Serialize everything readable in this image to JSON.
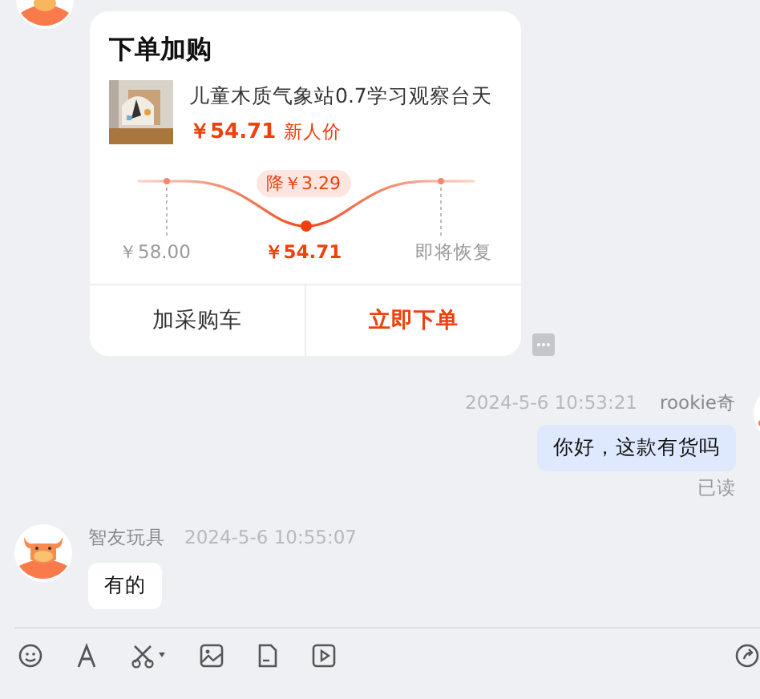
{
  "order_card": {
    "title": "下单加购",
    "product": {
      "name": "儿童木质气象站0.7学习观察台天",
      "price": "￥54.71",
      "price_tag": "新人价"
    },
    "price_chart": {
      "badge": "降￥3.29",
      "points": [
        {
          "label": "￥58.00",
          "current": false
        },
        {
          "label": "￥54.71",
          "current": true
        },
        {
          "label": "即将恢复",
          "current": false
        }
      ]
    },
    "buttons": [
      {
        "label": "加采购车",
        "primary": false
      },
      {
        "label": "立即下单",
        "primary": true
      }
    ]
  },
  "outgoing": {
    "time": "2024-5-6 10:53:21",
    "sender": "rookie奇",
    "text": "你好，这款有货吗",
    "status": "已读"
  },
  "incoming": {
    "sender": "智友玩具",
    "time": "2024-5-6 10:55:07",
    "text": "有的"
  }
}
